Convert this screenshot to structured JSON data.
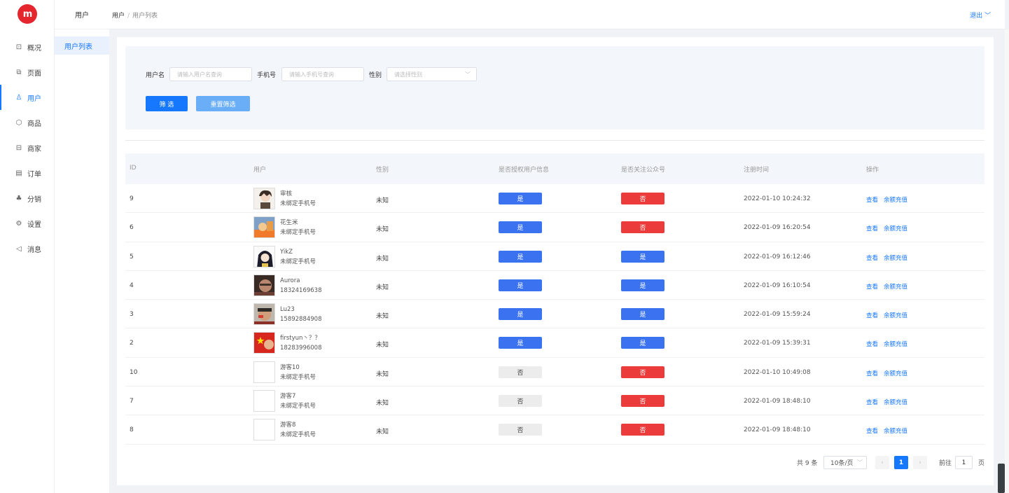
{
  "logo": {
    "text": "m"
  },
  "nav": [
    {
      "icon": "⊡",
      "label": "概况"
    },
    {
      "icon": "⧉",
      "label": "页面"
    },
    {
      "icon": "♙",
      "label": "用户"
    },
    {
      "icon": "⬡",
      "label": "商品"
    },
    {
      "icon": "⊟",
      "label": "商家"
    },
    {
      "icon": "▤",
      "label": "订单"
    },
    {
      "icon": "♣",
      "label": "分销"
    },
    {
      "icon": "⚙",
      "label": "设置"
    },
    {
      "icon": "◁",
      "label": "消息"
    }
  ],
  "subnav": {
    "title": "用户",
    "item": "用户列表"
  },
  "header": {
    "crumb_root": "用户",
    "crumb_sep": "/",
    "crumb_current": "用户列表",
    "logout": "退出 ﹀"
  },
  "filter": {
    "username_label": "用户名",
    "username_placeholder": "请输入用户名查询",
    "phone_label": "手机号",
    "phone_placeholder": "请输入手机号查询",
    "gender_label": "性别",
    "gender_placeholder": "请选择性别",
    "submit": "筛 选",
    "reset": "重置筛选"
  },
  "table": {
    "headers": [
      "ID",
      "用户",
      "性别",
      "是否授权用户信息",
      "是否关注公众号",
      "注册时间",
      "操作"
    ],
    "rows": [
      {
        "id": "9",
        "name": "审核",
        "phone": "未绑定手机号",
        "gender": "未知",
        "auth": "是",
        "follow": "否",
        "time": "2022-01-10 10:24:32",
        "avatar": "anime-boy"
      },
      {
        "id": "6",
        "name": "花生米",
        "phone": "未绑定手机号",
        "gender": "未知",
        "auth": "是",
        "follow": "否",
        "time": "2022-01-09 16:20:54",
        "avatar": "orange"
      },
      {
        "id": "5",
        "name": "YikZ",
        "phone": "未绑定手机号",
        "gender": "未知",
        "auth": "是",
        "follow": "是",
        "time": "2022-01-09 16:12:46",
        "avatar": "anime-girl"
      },
      {
        "id": "4",
        "name": "Aurora",
        "phone": "18324169638",
        "gender": "未知",
        "auth": "是",
        "follow": "是",
        "time": "2022-01-09 16:10:54",
        "avatar": "face-dark"
      },
      {
        "id": "3",
        "name": "Lu23",
        "phone": "15892884908",
        "gender": "未知",
        "auth": "是",
        "follow": "是",
        "time": "2022-01-09 15:59:24",
        "avatar": "face-flag"
      },
      {
        "id": "2",
        "name": "firstyun丶？？",
        "phone": "18283996008",
        "gender": "未知",
        "auth": "是",
        "follow": "是",
        "time": "2022-01-09 15:39:31",
        "avatar": "red-flag"
      },
      {
        "id": "10",
        "name": "游客10",
        "phone": "未绑定手机号",
        "gender": "未知",
        "auth": "否",
        "follow": "否",
        "time": "2022-01-10 10:49:08",
        "avatar": "blank"
      },
      {
        "id": "7",
        "name": "游客7",
        "phone": "未绑定手机号",
        "gender": "未知",
        "auth": "否",
        "follow": "否",
        "time": "2022-01-09 18:48:10",
        "avatar": "blank"
      },
      {
        "id": "8",
        "name": "游客8",
        "phone": "未绑定手机号",
        "gender": "未知",
        "auth": "否",
        "follow": "否",
        "time": "2022-01-09 18:48:10",
        "avatar": "blank"
      }
    ],
    "op_view": "查看",
    "op_recharge": "余额充值"
  },
  "pager": {
    "total": "共 9 条",
    "size": "10条/页",
    "prev": "‹",
    "page": "1",
    "next": "›",
    "goto": "前往",
    "goto_value": "1",
    "suffix": "页"
  },
  "colors": {
    "primary": "#1677ff",
    "yes": "#3a72f0",
    "no": "#eb3b3b",
    "brand": "#e5262e"
  }
}
